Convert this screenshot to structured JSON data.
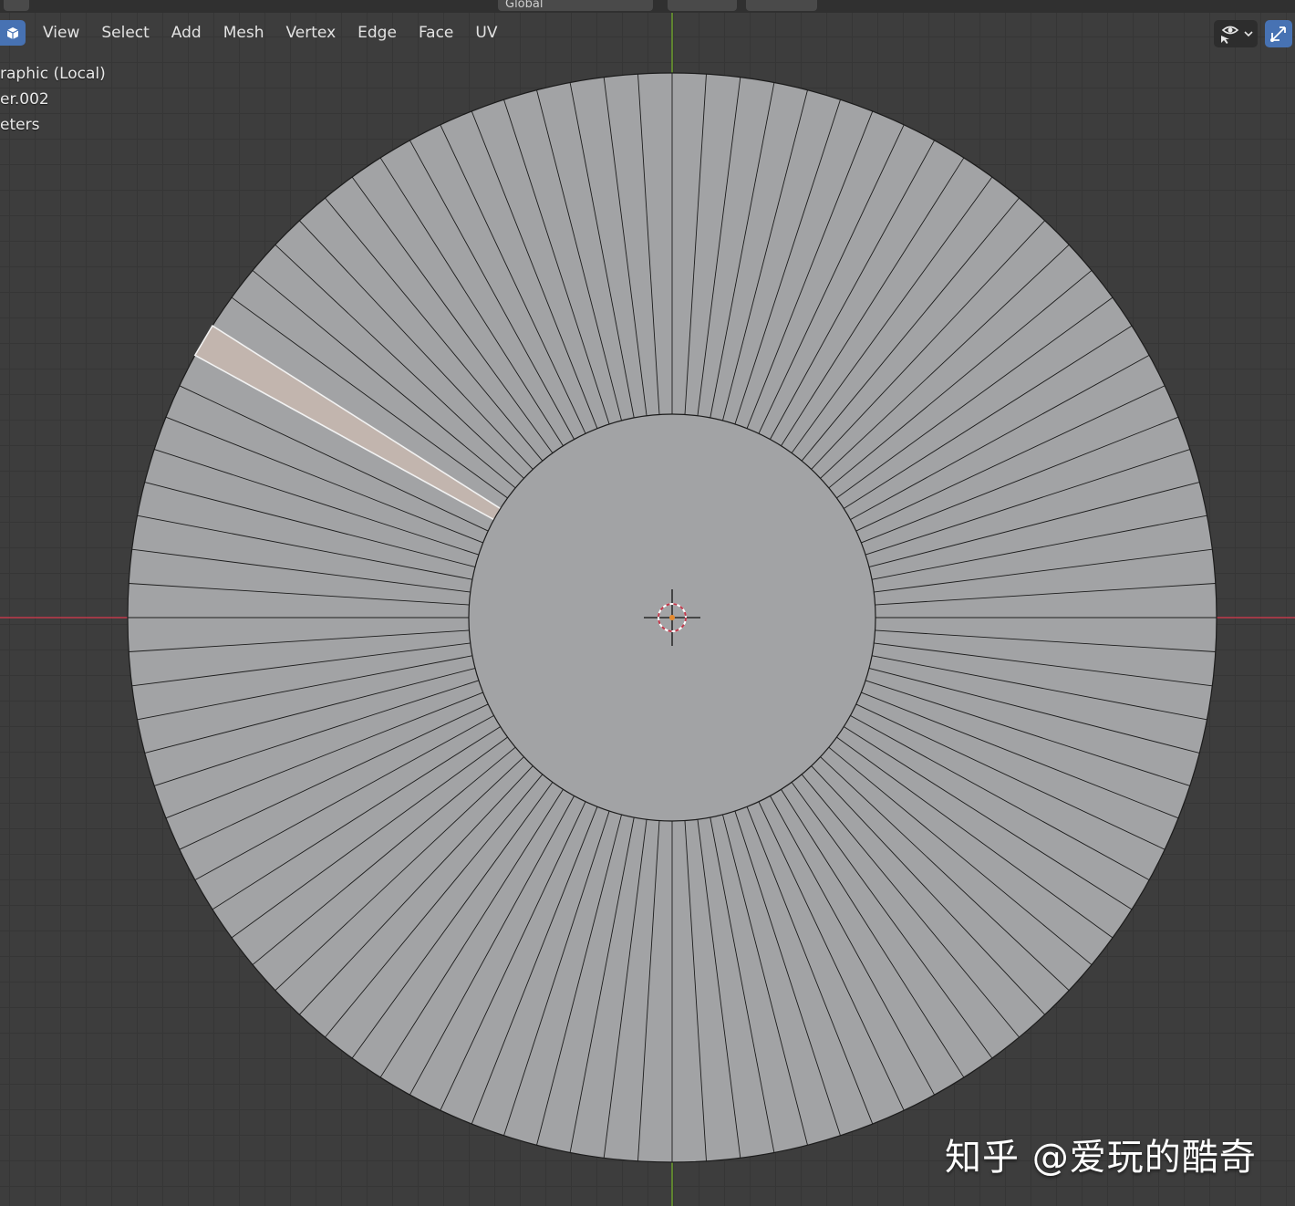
{
  "header": {
    "transform_orientation": "Global"
  },
  "menu": {
    "items": [
      "View",
      "Select",
      "Add",
      "Mesh",
      "Vertex",
      "Edge",
      "Face",
      "UV"
    ]
  },
  "overlay": {
    "view_name": "raphic (Local)",
    "object_name": "er.002",
    "units": "eters"
  },
  "mesh": {
    "segments": 100,
    "selected_segment": 83,
    "outer_radius_ratio": 1.0,
    "inner_radius_ratio": 0.373
  },
  "colors": {
    "accent": "#4772b3",
    "mesh_face": "#a2a3a5",
    "mesh_edge": "#1c1c1c",
    "selected_face": "#c2b5ae",
    "x_axis": "#c0394b",
    "y_axis": "#6a9c2c"
  },
  "watermark": {
    "text": "知乎 @爱玩的酷奇"
  }
}
